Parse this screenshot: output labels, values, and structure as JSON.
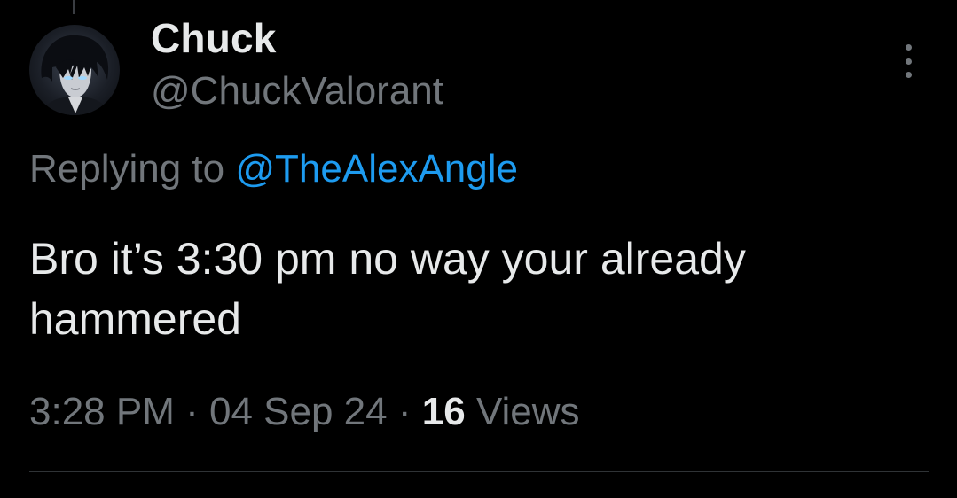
{
  "tweet": {
    "display_name": "Chuck",
    "handle": "@ChuckValorant",
    "replying_prefix": "Replying to",
    "replying_to": "@TheAlexAngle",
    "text": "Bro it’s 3:30 pm no way your already hammered",
    "time": "3:28 PM",
    "separator": "·",
    "date": "04 Sep 24",
    "views_count": "16",
    "views_label": "Views"
  },
  "icons": {
    "more": "more-options-icon",
    "avatar": "profile-avatar"
  },
  "colors": {
    "background": "#000000",
    "primary_text": "#e7e9ea",
    "secondary_text": "#71767b",
    "link": "#1d9bf0",
    "divider": "#2f3336"
  }
}
